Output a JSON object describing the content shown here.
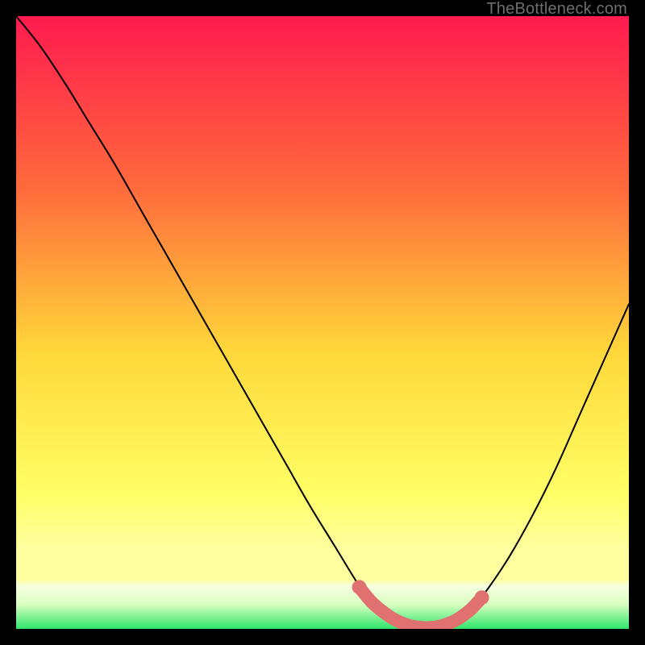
{
  "watermark": "TheBottleneck.com",
  "colors": {
    "bg_black": "#000000",
    "grad_top": "#ff1a4f",
    "grad_mid1": "#ff6a3c",
    "grad_mid2": "#ffd83a",
    "grad_mid3": "#ffff66",
    "grad_band_yellow": "#ffffa0",
    "grad_band_ghost": "#f7ffe0",
    "grad_bottom_green": "#2ee66b",
    "curve": "#000000",
    "marker": "#e17070"
  },
  "chart_data": {
    "type": "line",
    "title": "",
    "xlabel": "",
    "ylabel": "",
    "xlim": [
      0,
      100
    ],
    "ylim": [
      0,
      100
    ],
    "series": [
      {
        "name": "bottleneck-curve",
        "x": [
          0,
          4,
          8,
          12,
          16,
          20,
          24,
          28,
          32,
          36,
          40,
          44,
          48,
          52,
          56,
          58,
          60,
          62,
          64,
          66,
          68,
          70,
          72,
          74,
          76,
          80,
          84,
          88,
          92,
          96,
          100
        ],
        "y": [
          100,
          95,
          89,
          82.5,
          76,
          69,
          62,
          55,
          48,
          41,
          34,
          27,
          20,
          13.5,
          7,
          4.5,
          2.8,
          1.5,
          0.6,
          0.2,
          0.2,
          0.7,
          1.6,
          3,
          5.2,
          11,
          18,
          26,
          35,
          44,
          53
        ]
      }
    ],
    "markers": {
      "name": "optimal-range",
      "x": [
        56,
        58,
        60,
        62,
        64,
        66,
        68,
        70,
        72,
        74,
        75,
        76
      ],
      "y": [
        6.8,
        4.4,
        2.7,
        1.4,
        0.6,
        0.25,
        0.25,
        0.7,
        1.55,
        3.0,
        4.0,
        5.1
      ]
    }
  }
}
